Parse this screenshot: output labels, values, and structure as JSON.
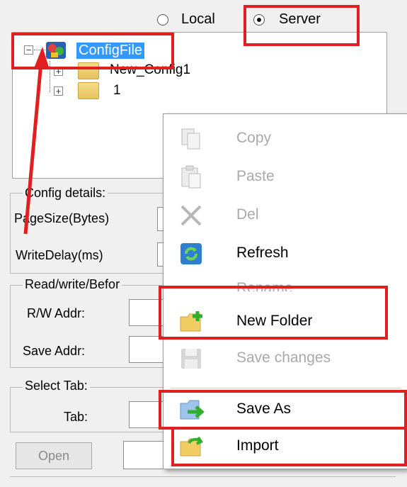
{
  "source": {
    "local_label": "Local",
    "server_label": "Server",
    "selected": "Server"
  },
  "tree": {
    "root_label": "ConfigFile",
    "children": [
      {
        "label": "New_Config1"
      },
      {
        "label": "1"
      }
    ]
  },
  "config_details": {
    "title": "Config details:",
    "page_size_label": "PageSize(Bytes)",
    "write_delay_label": "WriteDelay(ms)"
  },
  "rw_group": {
    "title": "Read/write/Befor",
    "rw_addr_label": "R/W Addr:",
    "save_addr_label": "Save Addr:"
  },
  "select_tab": {
    "title": "Select Tab:",
    "tab_label": "Tab:"
  },
  "buttons": {
    "open_label": "Open"
  },
  "context_menu": {
    "items": [
      {
        "label": "Copy",
        "enabled": false,
        "icon": "copy-icon"
      },
      {
        "label": "Paste",
        "enabled": false,
        "icon": "paste-icon"
      },
      {
        "label": "Del",
        "enabled": false,
        "icon": "delete-icon"
      },
      {
        "label": "Refresh",
        "enabled": true,
        "icon": "refresh-icon"
      },
      {
        "label": "Rename",
        "enabled": false,
        "icon": ""
      },
      {
        "label": "New Folder",
        "enabled": true,
        "icon": "new-folder-icon"
      },
      {
        "label": "Save changes",
        "enabled": false,
        "icon": "save-icon"
      },
      {
        "label": "Save As",
        "enabled": true,
        "icon": "save-as-icon"
      },
      {
        "label": "Import",
        "enabled": true,
        "icon": "import-icon"
      }
    ]
  },
  "colors": {
    "highlight": "#e02020",
    "selection": "#3399ff"
  }
}
